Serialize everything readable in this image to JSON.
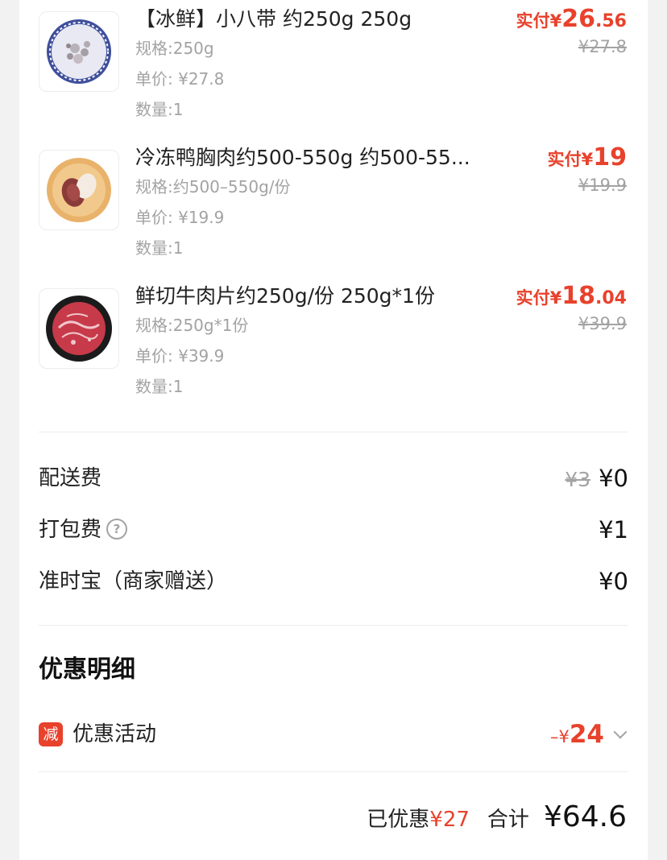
{
  "items": [
    {
      "name": "【冰鲜】小八带 约250g 250g",
      "spec": "规格:250g",
      "unit_price": "单价: ¥27.8",
      "qty": "数量:1",
      "paid_label": "实付",
      "paid_yen": "¥",
      "paid_int": "26",
      "paid_dec": ".56",
      "original": "¥27.8",
      "image_icon": "octopus-dish-icon"
    },
    {
      "name": "冷冻鸭胸肉约500-550g 约500-55...",
      "spec": "规格:约500–550g/份",
      "unit_price": "单价: ¥19.9",
      "qty": "数量:1",
      "paid_label": "实付",
      "paid_yen": "¥",
      "paid_int": "19",
      "paid_dec": "",
      "original": "¥19.9",
      "image_icon": "duck-breast-dish-icon"
    },
    {
      "name": "鲜切牛肉片约250g/份 250g*1份",
      "spec": "规格:250g*1份",
      "unit_price": "单价: ¥39.9",
      "qty": "数量:1",
      "paid_label": "实付",
      "paid_yen": "¥",
      "paid_int": "18",
      "paid_dec": ".04",
      "original": "¥39.9",
      "image_icon": "beef-slices-dish-icon"
    }
  ],
  "fees": {
    "delivery": {
      "label": "配送费",
      "original": "¥3",
      "value": "¥0"
    },
    "packaging": {
      "label": "打包费",
      "help_icon": "?",
      "value": "¥1"
    },
    "ontime": {
      "label": "准时宝（商家赠送）",
      "value": "¥0"
    }
  },
  "discount": {
    "title": "优惠明细",
    "badge": "减",
    "label": "优惠活动",
    "prefix": "–¥",
    "amount": "24"
  },
  "summary": {
    "saved_label": "已优惠",
    "saved_value": "¥27",
    "total_label": "合计",
    "total_value": "¥64.6"
  },
  "colors": {
    "accent": "#e8412c",
    "muted": "#a3a3a3",
    "text": "#222222"
  }
}
